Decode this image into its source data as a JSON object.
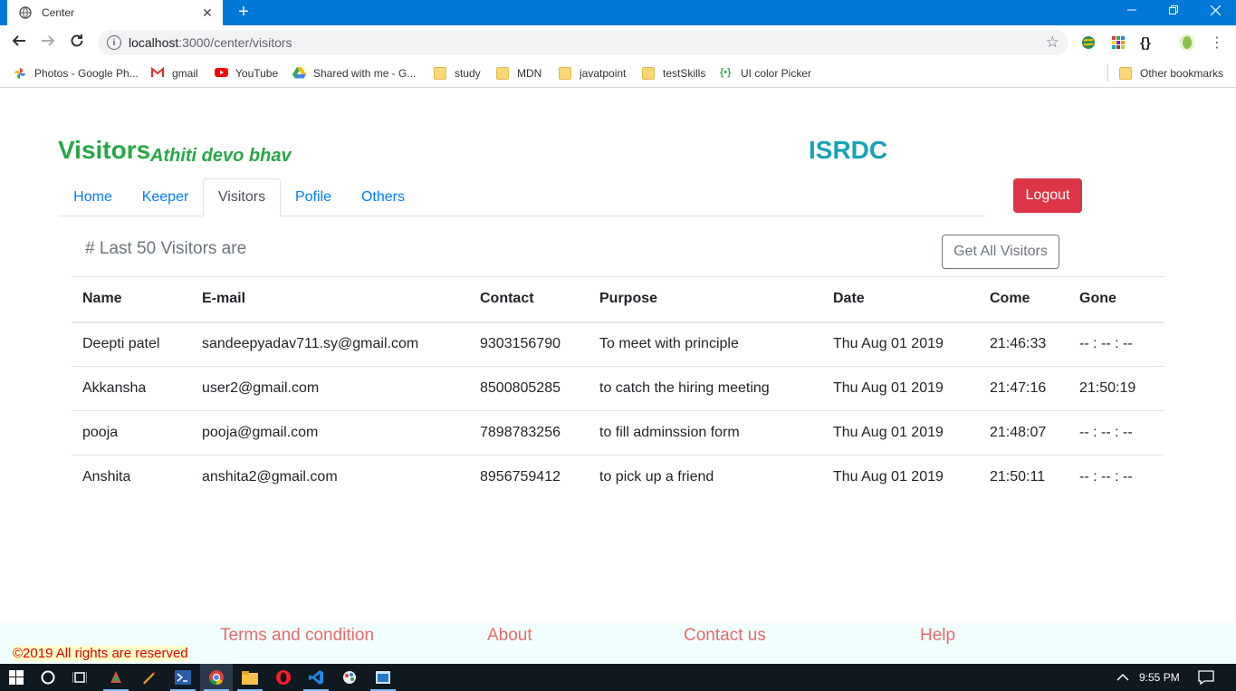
{
  "browser": {
    "tab_title": "Center",
    "new_tab_symbol": "+",
    "url_host": "localhost",
    "url_rest": ":3000/center/visitors",
    "bookmarks": [
      {
        "label": "Photos - Google Ph...",
        "icon": "google-photos-icon"
      },
      {
        "label": "gmail",
        "icon": "gmail-icon"
      },
      {
        "label": "YouTube",
        "icon": "youtube-icon"
      },
      {
        "label": "Shared with me - G...",
        "icon": "google-drive-icon"
      },
      {
        "label": "study",
        "icon": "folder-icon"
      },
      {
        "label": "MDN",
        "icon": "folder-icon"
      },
      {
        "label": "javatpoint",
        "icon": "folder-icon"
      },
      {
        "label": "testSkills",
        "icon": "folder-icon"
      },
      {
        "label": "UI color Picker",
        "icon": "color-picker-icon"
      }
    ],
    "other_bookmarks": "Other bookmarks"
  },
  "header": {
    "brand": "Visitors",
    "brand_sub": "Athiti devo bhav",
    "org": "ISRDC",
    "logout_label": "Logout"
  },
  "nav": {
    "tabs": [
      {
        "label": "Home",
        "active": false
      },
      {
        "label": "Keeper",
        "active": false
      },
      {
        "label": "Visitors",
        "active": true
      },
      {
        "label": "Pofile",
        "active": false
      },
      {
        "label": "Others",
        "active": false
      }
    ]
  },
  "main": {
    "heading": "# Last 50 Visitors are",
    "get_all_label": "Get All Visitors",
    "columns": [
      "Name",
      "E-mail",
      "Contact",
      "Purpose",
      "Date",
      "Come",
      "Gone"
    ],
    "rows": [
      [
        "Deepti patel",
        "sandeepyadav711.sy@gmail.com",
        "9303156790",
        "To meet with principle",
        "Thu Aug 01 2019",
        "21:46:33",
        "-- : -- : --"
      ],
      [
        "Akkansha",
        "user2@gmail.com",
        "8500805285",
        "to catch the hiring meeting",
        "Thu Aug 01 2019",
        "21:47:16",
        "21:50:19"
      ],
      [
        "pooja",
        "pooja@gmail.com",
        "7898783256",
        "to fill adminssion form",
        "Thu Aug 01 2019",
        "21:48:07",
        "-- : -- : --"
      ],
      [
        "Anshita",
        "anshita2@gmail.com",
        "8956759412",
        "to pick up a friend",
        "Thu Aug 01 2019",
        "21:50:11",
        "-- : -- : --"
      ]
    ]
  },
  "footer": {
    "links": [
      "Terms and condition",
      "About",
      "Contact us",
      "Help"
    ],
    "copyright": "©2019 All rights are reserved"
  },
  "taskbar": {
    "time": "9:55 PM"
  },
  "colors": {
    "brand_green": "#28a745",
    "isrdc_teal": "#17a2b8",
    "logout_red": "#dc3545",
    "link_blue": "#007bff",
    "footer_link": "#e86a6a",
    "chrome_blue": "#0078d7"
  }
}
